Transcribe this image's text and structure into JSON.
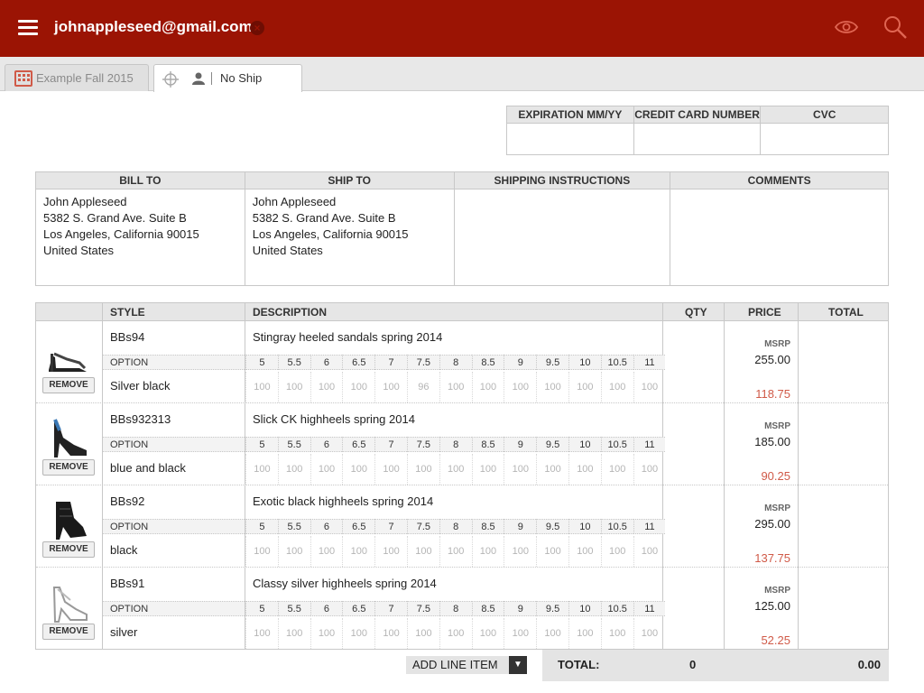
{
  "header": {
    "email": "johnappleseed@gmail.com",
    "clear_icon": "x-circle-icon",
    "bg_color": "#9b1404"
  },
  "tabs": [
    {
      "label": "Example Fall 2015",
      "icon": "calendar-icon"
    },
    {
      "label": "No Ship",
      "icons": [
        "crosshair-icon",
        "person-icon"
      ]
    }
  ],
  "payment": {
    "headers": [
      "EXPIRATION MM/YY",
      "CREDIT CARD NUMBER",
      "CVC"
    ],
    "values": [
      "",
      "",
      ""
    ]
  },
  "addresses": {
    "headers": [
      "BILL TO",
      "SHIP TO",
      "SHIPPING INSTRUCTIONS",
      "COMMENTS"
    ],
    "bill_to": [
      "John Appleseed",
      "5382 S. Grand Ave. Suite B",
      "Los Angeles, California 90015",
      "United States"
    ],
    "ship_to": [
      "John Appleseed",
      "5382 S. Grand Ave. Suite B",
      "Los Angeles, California 90015",
      "United States"
    ],
    "shipping_instructions": "",
    "comments": ""
  },
  "order": {
    "headers": {
      "style": "STYLE",
      "description": "DESCRIPTION",
      "qty": "QTY",
      "price": "PRICE",
      "total": "TOTAL"
    },
    "option_label": "OPTION",
    "remove_label": "REMOVE",
    "msrp_label": "MSRP",
    "sizes": [
      "5",
      "5.5",
      "6",
      "6.5",
      "7",
      "7.5",
      "8",
      "8.5",
      "9",
      "9.5",
      "10",
      "10.5",
      "11"
    ],
    "items": [
      {
        "style": "BBs94",
        "description": "Stingray heeled sandals spring 2014",
        "color": "Silver black",
        "msrp": "255.00",
        "price": "118.75",
        "qty": [
          "100",
          "100",
          "100",
          "100",
          "100",
          "96",
          "100",
          "100",
          "100",
          "100",
          "100",
          "100",
          "100"
        ]
      },
      {
        "style": "BBs932313",
        "description": "Slick CK highheels spring 2014",
        "color": "blue and black",
        "msrp": "185.00",
        "price": "90.25",
        "qty": [
          "100",
          "100",
          "100",
          "100",
          "100",
          "100",
          "100",
          "100",
          "100",
          "100",
          "100",
          "100",
          "100"
        ]
      },
      {
        "style": "BBs92",
        "description": "Exotic black highheels spring 2014",
        "color": "black",
        "msrp": "295.00",
        "price": "137.75",
        "qty": [
          "100",
          "100",
          "100",
          "100",
          "100",
          "100",
          "100",
          "100",
          "100",
          "100",
          "100",
          "100",
          "100"
        ]
      },
      {
        "style": "BBs91",
        "description": "Classy silver highheels spring 2014",
        "color": "silver",
        "msrp": "125.00",
        "price": "52.25",
        "qty": [
          "100",
          "100",
          "100",
          "100",
          "100",
          "100",
          "100",
          "100",
          "100",
          "100",
          "100",
          "100",
          "100"
        ]
      }
    ]
  },
  "footer": {
    "add_line_item": "ADD LINE ITEM",
    "total_label": "TOTAL:",
    "total_qty": "0",
    "total_amount": "0.00"
  }
}
